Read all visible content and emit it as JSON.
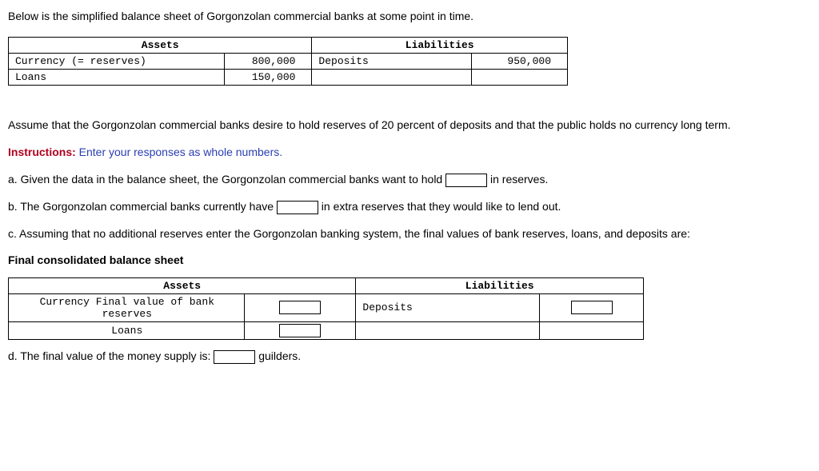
{
  "intro": "Below is the simplified balance sheet of Gorgonzolan commercial banks at some point in time.",
  "table1": {
    "header_assets": "Assets",
    "header_liabilities": "Liabilities",
    "row1": {
      "asset_label": "Currency (= reserves)",
      "asset_value": "800,000",
      "liab_label": "Deposits",
      "liab_value": "950,000"
    },
    "row2": {
      "asset_label": "Loans",
      "asset_value": "150,000"
    }
  },
  "assume": "Assume that the Gorgonzolan commercial banks desire to hold reserves of 20 percent of deposits and that the public holds no currency long term.",
  "instructions_label": "Instructions:",
  "instructions_text": " Enter your responses as whole numbers.",
  "qa_before": "a. Given the data in the balance sheet, the Gorgonzolan commercial banks want to hold ",
  "qa_after": " in reserves.",
  "qb_before": "b. The Gorgonzolan commercial banks currently have ",
  "qb_after": " in extra reserves that they would like to lend out.",
  "qc": "c. Assuming that no additional reserves enter the Gorgonzolan banking system, the final values of bank reserves, loans, and deposits are:",
  "final_title": "Final consolidated balance sheet",
  "table2": {
    "header_assets": "Assets",
    "header_liabilities": "Liabilities",
    "row1": {
      "asset_label": "Currency Final value of bank reserves",
      "liab_label": "Deposits"
    },
    "row2": {
      "asset_label": "Loans"
    }
  },
  "qd_before": "d. The final value of the money supply is: ",
  "qd_after": " guilders."
}
